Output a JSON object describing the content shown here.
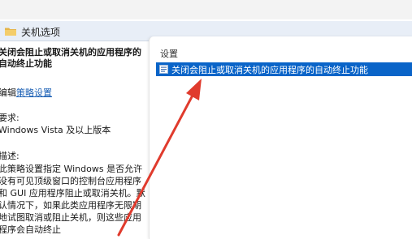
{
  "folder": {
    "icon": "folder-icon",
    "label": "关机选项"
  },
  "description": {
    "title_lines": [
      "关闭会阻止或取消关机的应用程序的",
      "自动终止功能"
    ],
    "edit_prefix": "编辑",
    "edit_link": "策略设置",
    "requirements_label": "要求:",
    "requirements_value": "Windows Vista 及以上版本",
    "desc_label": "描述:",
    "desc_lines": [
      "此策略设置指定 Windows 是否允许",
      "没有可见顶级窗口的控制台应用程序",
      "和 GUI 应用程序阻止或取消关机。默",
      "认情况下，如果此类应用程序无限期",
      "地试图取消或阻止关机，则这些应用",
      "程序会自动终止"
    ]
  },
  "settings": {
    "column_header": "设置",
    "items": [
      {
        "icon": "policy-setting-icon",
        "label": "关闭会阻止或取消关机的应用程序的自动终止功能",
        "selected": true
      }
    ]
  },
  "annotation": {
    "arrow_icon": "red-arrow-icon",
    "color": "#e03b2d"
  },
  "colors": {
    "selection": "#0a64c8",
    "link": "#1a5fb4",
    "header_bg": "#e8eef7"
  }
}
